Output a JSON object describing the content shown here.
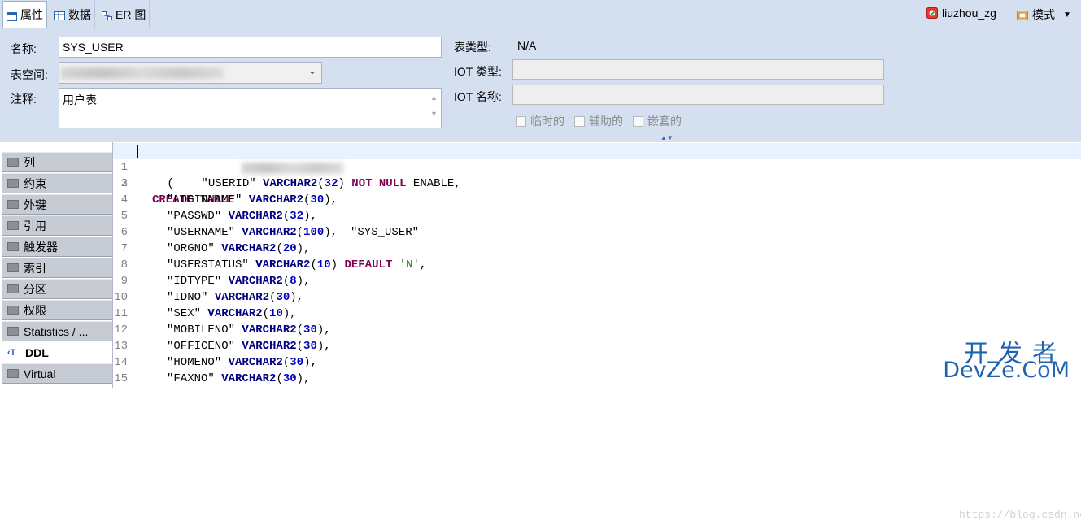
{
  "tabs": [
    {
      "label": "属性",
      "active": true
    },
    {
      "label": "数据",
      "active": false
    },
    {
      "label": "ER 图",
      "active": false
    }
  ],
  "connection": {
    "label": "liuzhou_zg"
  },
  "schema_menu": {
    "label": "模式"
  },
  "form": {
    "name_label": "名称:",
    "name_value": "SYS_USER",
    "tablespace_label": "表空间:",
    "comment_label": "注释:",
    "comment_value": "用户表",
    "table_type_label": "表类型:",
    "table_type_value": "N/A",
    "iot_type_label": "IOT 类型:",
    "iot_name_label": "IOT 名称:",
    "checkboxes": [
      "临时的",
      "辅助的",
      "嵌套的"
    ]
  },
  "sidebar": {
    "items": [
      {
        "label": "列"
      },
      {
        "label": "约束"
      },
      {
        "label": "外键"
      },
      {
        "label": "引用"
      },
      {
        "label": "触发器"
      },
      {
        "label": "索引"
      },
      {
        "label": "分区"
      },
      {
        "label": "权限"
      },
      {
        "label": "Statistics / ..."
      },
      {
        "label": "DDL",
        "active": true
      },
      {
        "label": "Virtual"
      }
    ]
  },
  "editor": {
    "line_numbers": [
      "1",
      "2",
      "3",
      "4",
      "5",
      "6",
      "7",
      "8",
      "9",
      "10",
      "11",
      "12",
      "13",
      "14",
      "15"
    ],
    "create_kw": "CREATE TABLE",
    "table_name": "\"SYS_USER\"",
    "columns": [
      {
        "open": " (    ",
        "name": "\"USERID\"",
        "type": "VARCHAR2",
        "size": "32",
        "suffix_kw": "NOT NULL",
        "suffix": " ENABLE,"
      },
      {
        "name": "\"LOGINNAME\"",
        "type": "VARCHAR2",
        "size": "30",
        "suffix": ","
      },
      {
        "name": "\"PASSWD\"",
        "type": "VARCHAR2",
        "size": "32",
        "suffix": ","
      },
      {
        "name": "\"USERNAME\"",
        "type": "VARCHAR2",
        "size": "100",
        "suffix": ","
      },
      {
        "name": "\"ORGNO\"",
        "type": "VARCHAR2",
        "size": "20",
        "suffix": ","
      },
      {
        "name": "\"USERSTATUS\"",
        "type": "VARCHAR2",
        "size": "10",
        "suffix_kw": "DEFAULT",
        "default_str": "'N'",
        "suffix": ","
      },
      {
        "name": "\"IDTYPE\"",
        "type": "VARCHAR2",
        "size": "8",
        "suffix": ","
      },
      {
        "name": "\"IDNO\"",
        "type": "VARCHAR2",
        "size": "30",
        "suffix": ","
      },
      {
        "name": "\"SEX\"",
        "type": "VARCHAR2",
        "size": "10",
        "suffix": ","
      },
      {
        "name": "\"MOBILENO\"",
        "type": "VARCHAR2",
        "size": "30",
        "suffix": ","
      },
      {
        "name": "\"OFFICENO\"",
        "type": "VARCHAR2",
        "size": "30",
        "suffix": ","
      },
      {
        "name": "\"HOMENO\"",
        "type": "VARCHAR2",
        "size": "30",
        "suffix": ","
      },
      {
        "name": "\"FAXNO\"",
        "type": "VARCHAR2",
        "size": "30",
        "suffix": ","
      }
    ]
  },
  "watermark": {
    "cn": "开发者",
    "en": "DevZe.CoM",
    "url": "https://blog.csdn.net"
  },
  "colors": {
    "panel": "#d4dff0",
    "keyword": "#7f0055",
    "type": "#000080",
    "number": "#0000c0",
    "string": "#008000"
  }
}
